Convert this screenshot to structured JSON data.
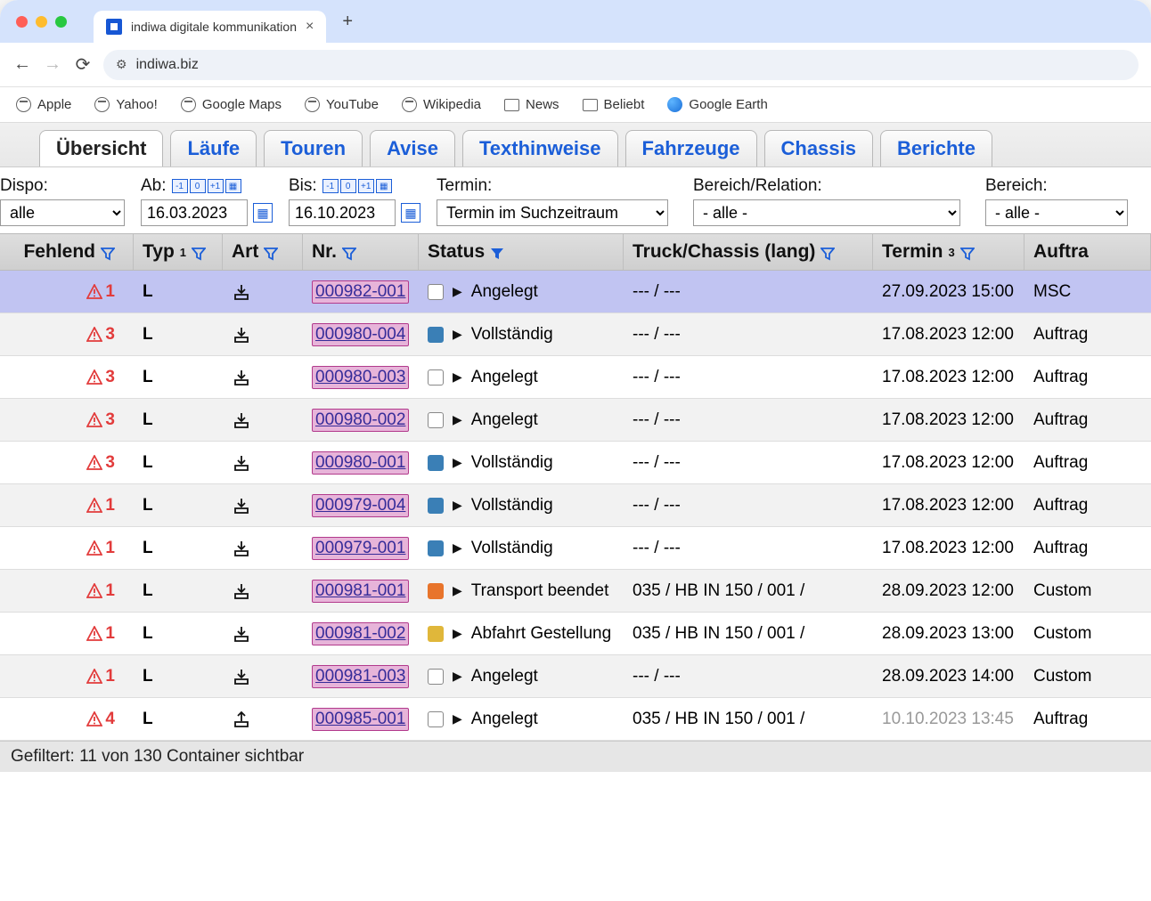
{
  "browser": {
    "tab_title": "indiwa digitale kommunikation",
    "url": "indiwa.biz",
    "bookmarks": [
      "Apple",
      "Yahoo!",
      "Google Maps",
      "YouTube",
      "Wikipedia",
      "News",
      "Beliebt",
      "Google Earth"
    ]
  },
  "app_tabs": [
    "Übersicht",
    "Läufe",
    "Touren",
    "Avise",
    "Texthinweise",
    "Fahrzeuge",
    "Chassis",
    "Berichte"
  ],
  "active_app_tab": 0,
  "filters": {
    "dispo_label": "Dispo:",
    "dispo_value": "alle",
    "ab_label": "Ab:",
    "ab_value": "16.03.2023",
    "bis_label": "Bis:",
    "bis_value": "16.10.2023",
    "termin_label": "Termin:",
    "termin_value": "Termin im Suchzeitraum",
    "bereich_rel_label": "Bereich/Relation:",
    "bereich_rel_value": "- alle -",
    "bereich_label": "Bereich:",
    "bereich_value": "- alle -",
    "mini_icons": [
      "-1",
      "0",
      "+1",
      "▦"
    ]
  },
  "columns": {
    "fehlend": "Fehlend",
    "typ": "Typ",
    "typ_sup": "1",
    "art": "Art",
    "nr": "Nr.",
    "status": "Status",
    "truck": "Truck/Chassis (lang)",
    "termin": "Termin",
    "termin_sup": "3",
    "auftr": "Auftra"
  },
  "rows": [
    {
      "fehlend": "1",
      "typ": "L",
      "art": "down",
      "nr": "000982-001",
      "status_color": "white",
      "status": "Angelegt",
      "truck": "--- / ---",
      "termin": "27.09.2023 15:00",
      "termin_dim": false,
      "auftr": "MSC",
      "selected": true
    },
    {
      "fehlend": "3",
      "typ": "L",
      "art": "down",
      "nr": "000980-004",
      "status_color": "blue",
      "status": "Vollständig",
      "truck": "--- / ---",
      "termin": "17.08.2023 12:00",
      "termin_dim": false,
      "auftr": "Auftrag"
    },
    {
      "fehlend": "3",
      "typ": "L",
      "art": "down",
      "nr": "000980-003",
      "status_color": "white",
      "status": "Angelegt",
      "truck": "--- / ---",
      "termin": "17.08.2023 12:00",
      "termin_dim": false,
      "auftr": "Auftrag"
    },
    {
      "fehlend": "3",
      "typ": "L",
      "art": "down",
      "nr": "000980-002",
      "status_color": "white",
      "status": "Angelegt",
      "truck": "--- / ---",
      "termin": "17.08.2023 12:00",
      "termin_dim": false,
      "auftr": "Auftrag"
    },
    {
      "fehlend": "3",
      "typ": "L",
      "art": "down",
      "nr": "000980-001",
      "status_color": "blue",
      "status": "Vollständig",
      "truck": "--- / ---",
      "termin": "17.08.2023 12:00",
      "termin_dim": false,
      "auftr": "Auftrag"
    },
    {
      "fehlend": "1",
      "typ": "L",
      "art": "down",
      "nr": "000979-004",
      "status_color": "blue",
      "status": "Vollständig",
      "truck": "--- / ---",
      "termin": "17.08.2023 12:00",
      "termin_dim": false,
      "auftr": "Auftrag"
    },
    {
      "fehlend": "1",
      "typ": "L",
      "art": "down",
      "nr": "000979-001",
      "status_color": "blue",
      "status": "Vollständig",
      "truck": "--- / ---",
      "termin": "17.08.2023 12:00",
      "termin_dim": false,
      "auftr": "Auftrag"
    },
    {
      "fehlend": "1",
      "typ": "L",
      "art": "down",
      "nr": "000981-001",
      "status_color": "orange",
      "status": "Transport beendet",
      "truck": "035 / HB IN 150 / 001 /",
      "termin": "28.09.2023 12:00",
      "termin_dim": false,
      "auftr": "Custom"
    },
    {
      "fehlend": "1",
      "typ": "L",
      "art": "down",
      "nr": "000981-002",
      "status_color": "yellow",
      "status": "Abfahrt Gestellung",
      "truck": "035 / HB IN 150 / 001 /",
      "termin": "28.09.2023 13:00",
      "termin_dim": false,
      "auftr": "Custom"
    },
    {
      "fehlend": "1",
      "typ": "L",
      "art": "down",
      "nr": "000981-003",
      "status_color": "white",
      "status": "Angelegt",
      "truck": "--- / ---",
      "termin": "28.09.2023 14:00",
      "termin_dim": false,
      "auftr": "Custom"
    },
    {
      "fehlend": "4",
      "typ": "L",
      "art": "up",
      "nr": "000985-001",
      "status_color": "white",
      "status": "Angelegt",
      "truck": "035 / HB IN 150 / 001 /",
      "termin": "10.10.2023 13:45",
      "termin_dim": true,
      "auftr": "Auftrag"
    }
  ],
  "footer": "Gefiltert: 11 von 130 Container sichtbar"
}
